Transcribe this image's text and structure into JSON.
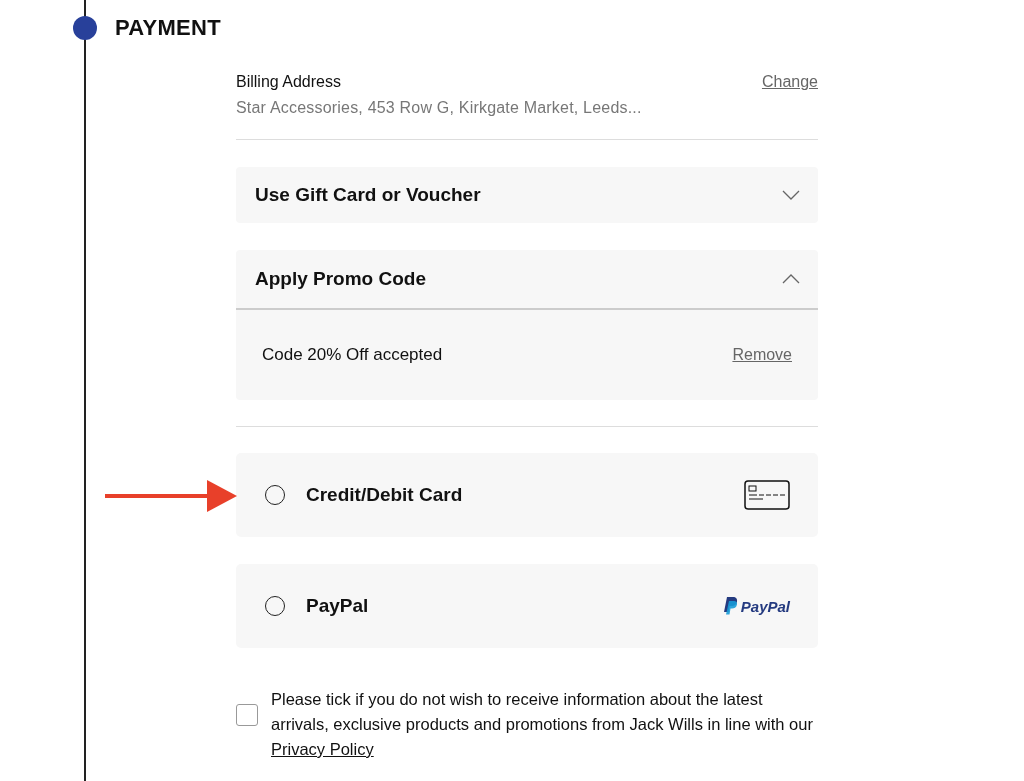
{
  "step": {
    "title": "PAYMENT"
  },
  "billing": {
    "label": "Billing Address",
    "address": "Star Accessories, 453 Row G, Kirkgate Market, Leeds...",
    "change_link": "Change"
  },
  "accordions": [
    {
      "title": "Use Gift Card or Voucher",
      "expanded": false
    },
    {
      "title": "Apply Promo Code",
      "expanded": true,
      "message": "Code 20% Off accepted",
      "action": "Remove"
    }
  ],
  "payment_methods": [
    {
      "label": "Credit/Debit Card",
      "kind": "card",
      "selected": false
    },
    {
      "label": "PayPal",
      "kind": "paypal",
      "selected": false,
      "logo_text": "PayPal"
    }
  ],
  "consent": {
    "checked": false,
    "text": "Please tick if you do not wish to receive information about the latest arrivals, exclusive products and promotions from Jack Wills in line with our ",
    "link": "Privacy Policy"
  }
}
